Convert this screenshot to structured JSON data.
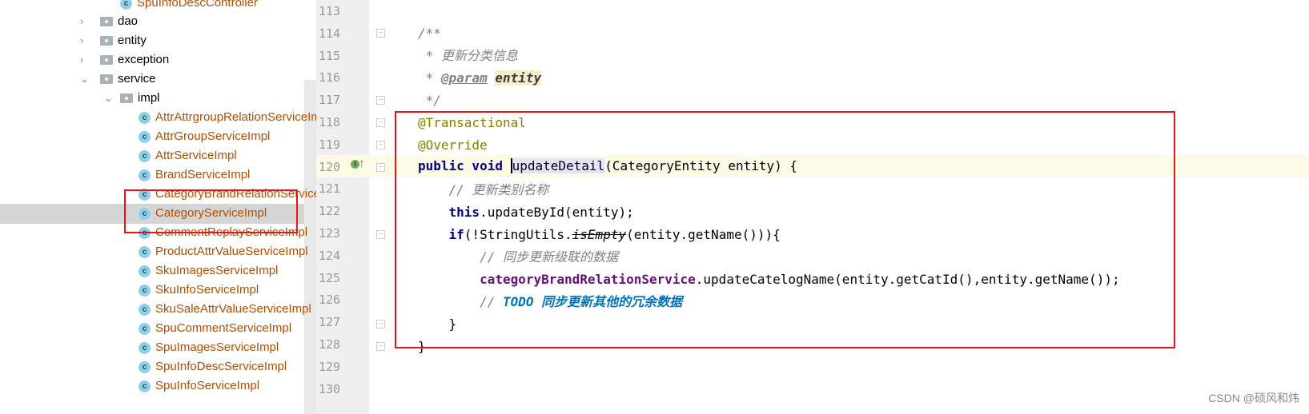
{
  "tree": {
    "top_item": "SpuInfoDescController",
    "folders": [
      "dao",
      "entity",
      "exception",
      "service"
    ],
    "subfolder": "impl",
    "classes": [
      "AttrAttrgroupRelationServiceImpl",
      "AttrGroupServiceImpl",
      "AttrServiceImpl",
      "BrandServiceImpl",
      "CategoryBrandRelationServiceImpl",
      "CategoryServiceImpl",
      "CommentReplayServiceImpl",
      "ProductAttrValueServiceImpl",
      "SkuImagesServiceImpl",
      "SkuInfoServiceImpl",
      "SkuSaleAttrValueServiceImpl",
      "SpuCommentServiceImpl",
      "SpuImagesServiceImpl",
      "SpuInfoDescServiceImpl",
      "SpuInfoServiceImpl"
    ],
    "selected": "CategoryServiceImpl",
    "class_icon_letter": "c"
  },
  "editor": {
    "line_numbers": [
      "113",
      "114",
      "115",
      "116",
      "117",
      "118",
      "119",
      "120",
      "121",
      "122",
      "123",
      "124",
      "125",
      "126",
      "127",
      "128",
      "129",
      "130"
    ],
    "current_line": "120",
    "lines": {
      "l114": "/**",
      "l115": " * 更新分类信息",
      "l116_pre": " * ",
      "l116_tag": "@param",
      "l116_ent": "entity",
      "l117": " */",
      "l118": "@Transactional",
      "l119": "@Override",
      "l120_kw": "public void ",
      "l120_name": "updateDetail",
      "l120_rest": "(CategoryEntity entity) {",
      "l121": "    // 更新类别名称",
      "l122_kw": "    this",
      "l122_rest": ".updateById(entity);",
      "l123_kw": "    if",
      "l123_a": "(!StringUtils.",
      "l123_m": "isEmpty",
      "l123_b": "(entity.getName())){",
      "l124": "        // 同步更新级联的数据",
      "l125_f": "        categoryBrandRelationService",
      "l125_rest": ".updateCatelogName(entity.getCatId(),entity.getName());",
      "l126_c": "        // ",
      "l126_todo": "TODO 同步更新其他的冗余数据",
      "l127": "    }",
      "l128": "}"
    },
    "gutter_icon": "implements-override-icon"
  },
  "watermark": "CSDN @硕风和炜",
  "colors": {
    "highlight_box": "#e8141c",
    "keyword": "#000080",
    "annotation": "#808000",
    "field": "#660e7a"
  }
}
